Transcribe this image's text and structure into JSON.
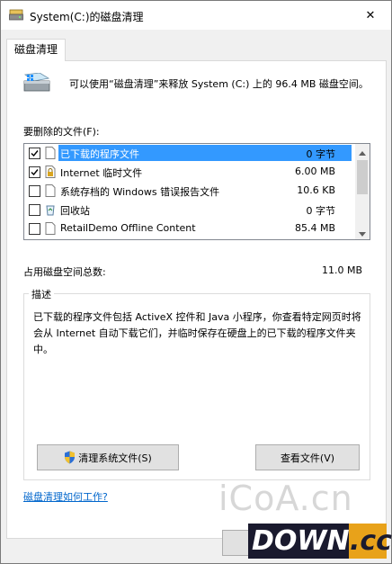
{
  "window": {
    "title": "System(C:)的磁盘清理",
    "close_glyph": "✕"
  },
  "tab": {
    "label": "磁盘清理"
  },
  "intro": "可以使用“磁盘清理”来释放 System (C:) 上的 96.4 MB 磁盘空间。",
  "files_label": "要删除的文件(F):",
  "files": [
    {
      "checked": true,
      "icon": "blank-file-icon",
      "name": "已下载的程序文件",
      "size": "0 字节",
      "selected": true
    },
    {
      "checked": true,
      "icon": "lock-file-icon",
      "name": "Internet 临时文件",
      "size": "6.00 MB",
      "selected": false
    },
    {
      "checked": false,
      "icon": "blank-file-icon",
      "name": "系统存档的 Windows 错误报告文件",
      "size": "10.6 KB",
      "selected": false
    },
    {
      "checked": false,
      "icon": "recycle-bin-icon",
      "name": "回收站",
      "size": "0 字节",
      "selected": false
    },
    {
      "checked": false,
      "icon": "blank-file-icon",
      "name": "RetailDemo Offline Content",
      "size": "85.4 MB",
      "selected": false
    }
  ],
  "total_label": "占用磁盘空间总数:",
  "total_value": "11.0 MB",
  "description": {
    "legend": "描述",
    "text": "已下载的程序文件包括 ActiveX 控件和 Java 小程序，你查看特定网页时将会从 Internet 自动下载它们，并临时保存在硬盘上的已下载的程序文件夹中。"
  },
  "buttons": {
    "clean_system": "清理系统文件(S)",
    "view_files": "查看文件(V)"
  },
  "help_link": "磁盘清理如何工作?",
  "watermark": {
    "site": "iCoA.cn",
    "logo_main": "DOWN",
    "logo_suffix": ".cc"
  },
  "colors": {
    "selection": "#3399ff",
    "link": "#0066cc"
  }
}
